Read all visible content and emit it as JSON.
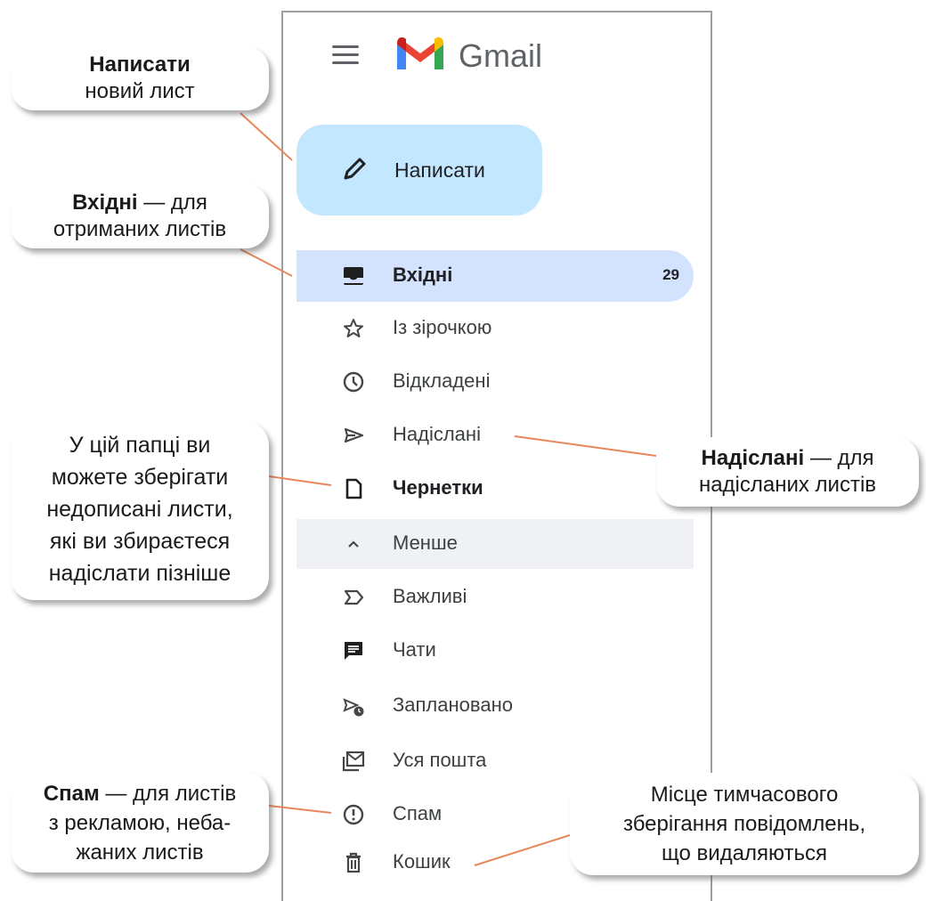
{
  "app": {
    "brand": "Gmail"
  },
  "compose": {
    "label": "Написати"
  },
  "nav": [
    {
      "id": "inbox",
      "label": "Вхідні",
      "count": "29",
      "icon": "inbox-icon",
      "active": true
    },
    {
      "id": "starred",
      "label": "Із зірочкою",
      "icon": "star-icon"
    },
    {
      "id": "snoozed",
      "label": "Відкладені",
      "icon": "clock-icon"
    },
    {
      "id": "sent",
      "label": "Надіслані",
      "icon": "send-icon"
    },
    {
      "id": "drafts",
      "label": "Чернетки",
      "icon": "draft-icon"
    },
    {
      "id": "less",
      "label": "Менше",
      "icon": "chevron-up-icon"
    },
    {
      "id": "important",
      "label": "Важливі",
      "icon": "important-icon"
    },
    {
      "id": "chats",
      "label": "Чати",
      "icon": "chat-icon"
    },
    {
      "id": "scheduled",
      "label": "Заплановано",
      "icon": "scheduled-icon"
    },
    {
      "id": "allmail",
      "label": "Уся пошта",
      "icon": "all-mail-icon"
    },
    {
      "id": "spam",
      "label": "Спам",
      "icon": "spam-icon"
    },
    {
      "id": "trash",
      "label": "Кошик",
      "icon": "trash-icon"
    }
  ],
  "callouts": {
    "compose": {
      "title": "Написати",
      "text": "новий лист"
    },
    "inbox": {
      "title": "Вхідні",
      "text1": " — для",
      "text2": "отриманих листів"
    },
    "drafts": {
      "line1": "У цій папці ви",
      "line2": "можете зберігати",
      "line3": "недописані листи,",
      "line4": "які ви збираєтеся",
      "line5": "надіслати пізніше"
    },
    "sent": {
      "title": "Надіслані",
      "text1": " — для",
      "text2": "надісланих листів"
    },
    "spam": {
      "title": "Спам",
      "text1": " — для листів",
      "text2": "з рекламою, неба-",
      "text3": "жаних листів"
    },
    "trash": {
      "line1": "Місце тимчасового",
      "line2": "зберігання повідомлень,",
      "line3": "що видаляються"
    }
  },
  "colors": {
    "compose_bg": "#c2e7ff",
    "active_bg": "#d3e3fd",
    "leader": "#e8875b"
  }
}
